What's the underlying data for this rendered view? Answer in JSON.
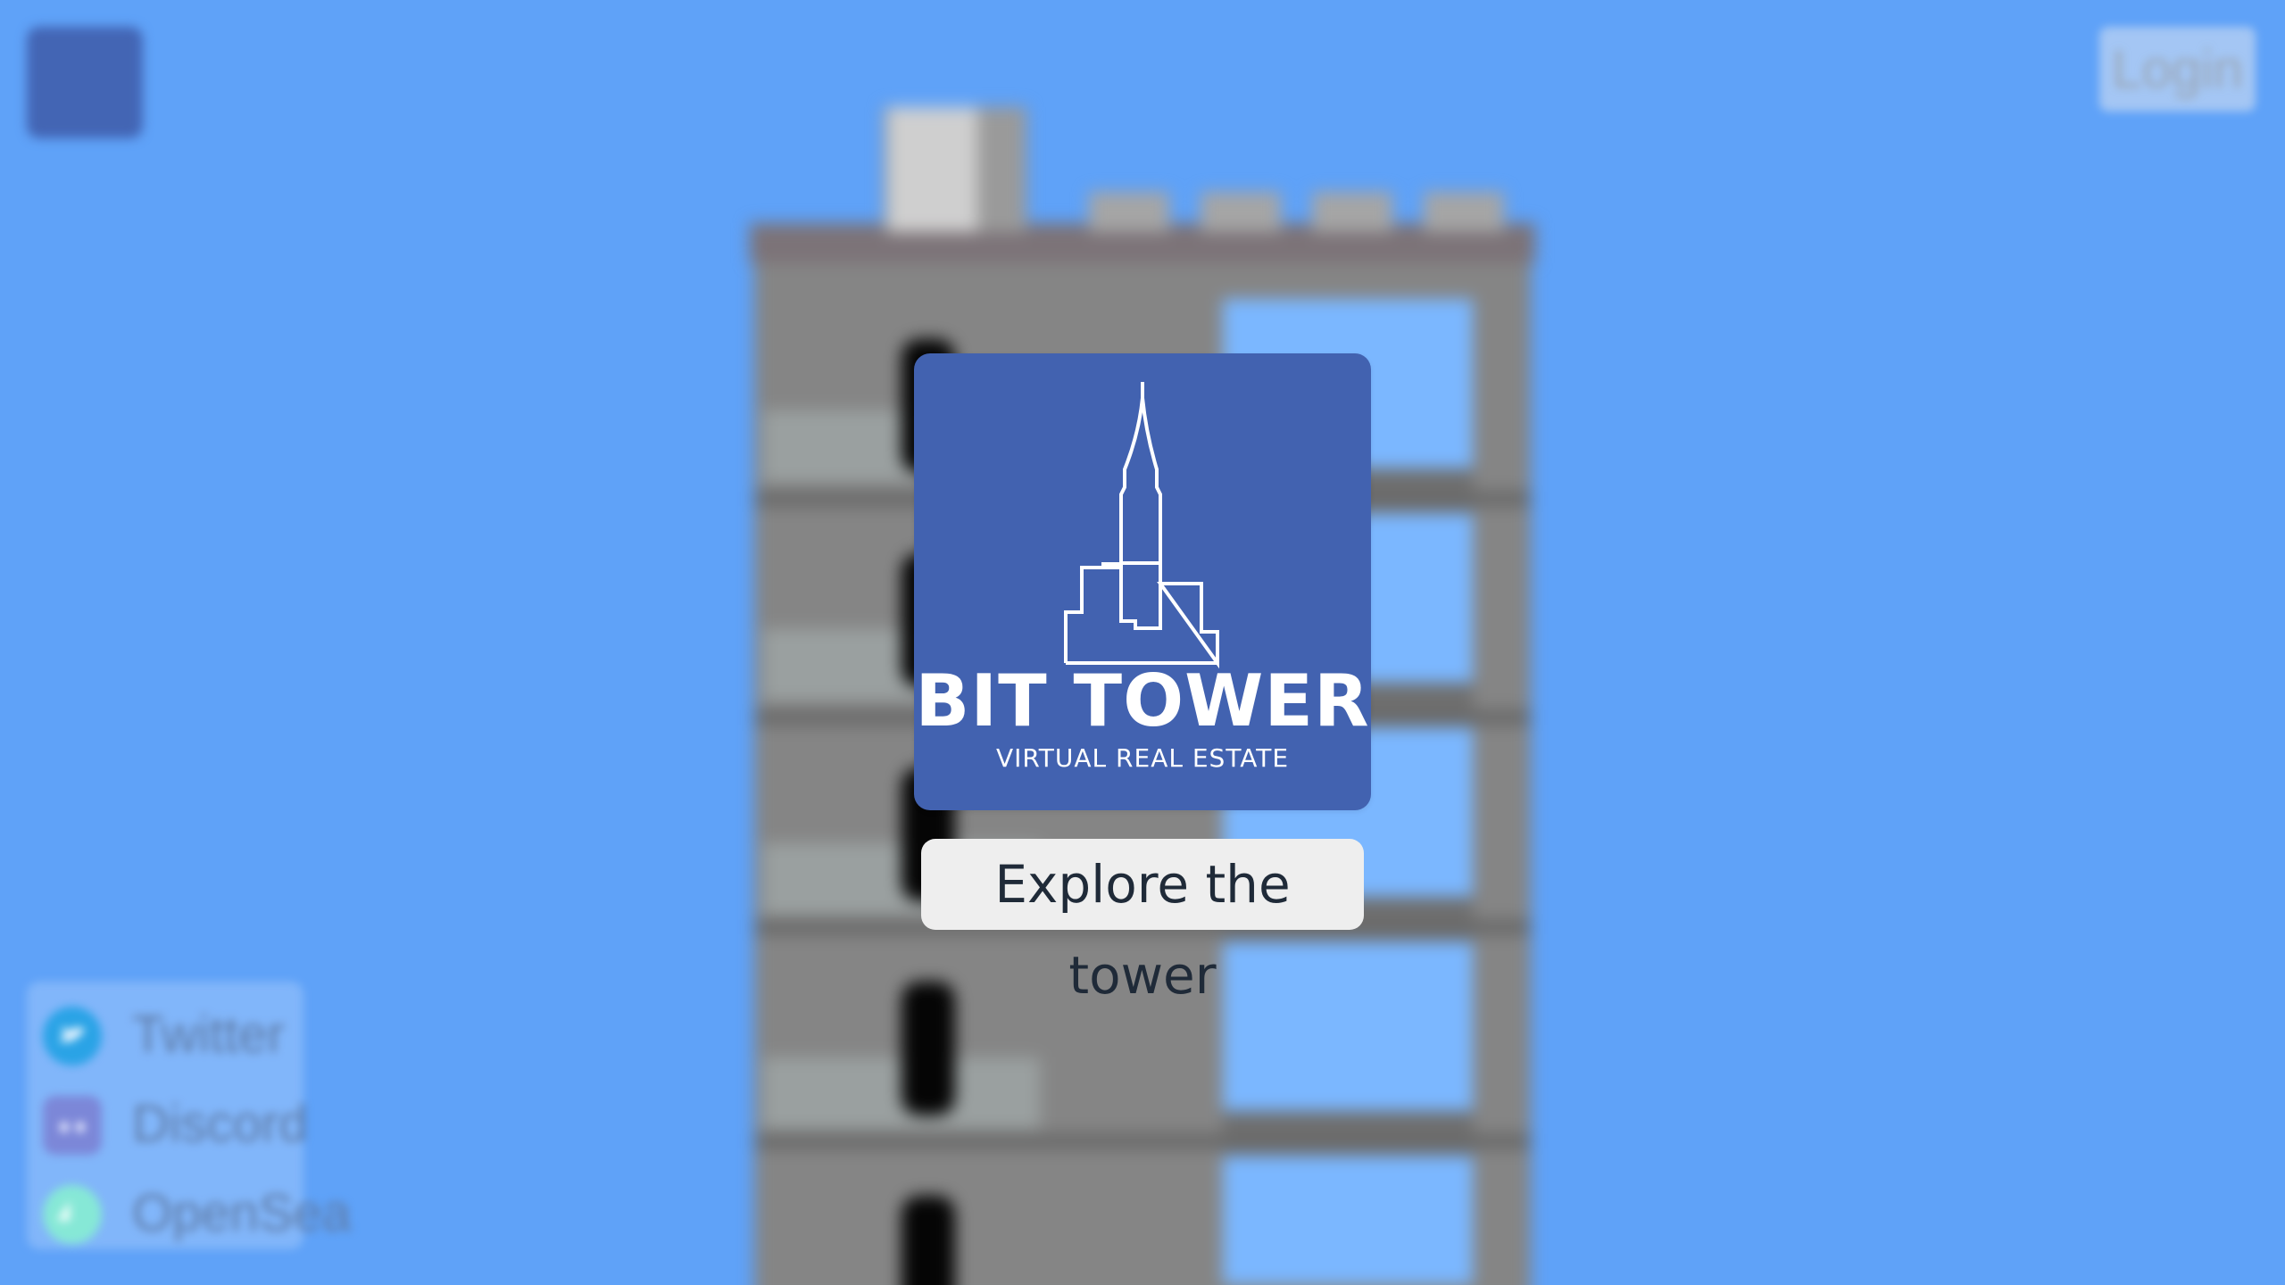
{
  "header": {
    "login_label": "Login",
    "corner_logo_icon": "bit-tower-logo-icon"
  },
  "brand": {
    "title": "BIT TOWER",
    "subtitle": "VIRTUAL REAL ESTATE",
    "logo_icon": "skyscraper-outline-icon",
    "card_color": "#4262b0"
  },
  "main": {
    "explore_label": "Explore the tower"
  },
  "social": {
    "items": [
      {
        "label": "Twitter",
        "icon": "twitter-icon",
        "color": "#1da1f2"
      },
      {
        "label": "Discord",
        "icon": "discord-icon",
        "color": "#7289da"
      },
      {
        "label": "OpenSea",
        "icon": "opensea-icon",
        "color": "#7ee6d0"
      }
    ]
  },
  "colors": {
    "sky": "#5fa2f8",
    "button_bg": "#eeeeee",
    "button_text": "#1f2a38"
  }
}
